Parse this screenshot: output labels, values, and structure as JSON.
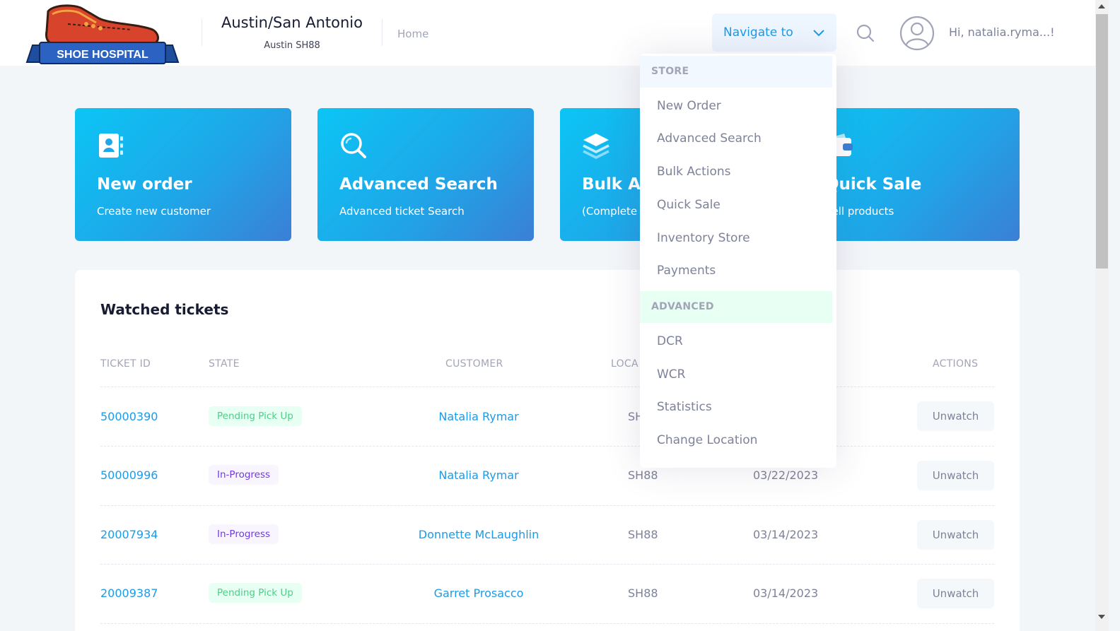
{
  "header": {
    "logo_text": "SHOE HOSPITAL",
    "store_name": "Austin/San Antonio",
    "store_code": "Austin SH88",
    "home_label": "Home",
    "navigate_label": "Navigate to",
    "greeting": "Hi, natalia.ryma...!"
  },
  "cards": [
    {
      "title": "New order",
      "subtitle": "Create new customer",
      "icon": "contact-book-icon"
    },
    {
      "title": "Advanced Search",
      "subtitle": "Advanced ticket Search",
      "icon": "search-icon"
    },
    {
      "title": "Bulk Actions",
      "subtitle": "(Complete",
      "icon": "layers-icon"
    },
    {
      "title": "Quick Sale",
      "subtitle": "Sell products",
      "icon": "wallet-icon"
    }
  ],
  "watched": {
    "title": "Watched tickets",
    "columns": [
      "TICKET ID",
      "STATE",
      "CUSTOMER",
      "LOCA",
      "ACTIONS"
    ],
    "rows": [
      {
        "id": "50000390",
        "state": "Pending Pick Up",
        "customer": "Natalia Rymar",
        "location": "SH",
        "date": "",
        "action": "Unwatch"
      },
      {
        "id": "50000996",
        "state": "In-Progress",
        "customer": "Natalia Rymar",
        "location": "SH88",
        "date": "03/22/2023",
        "action": "Unwatch"
      },
      {
        "id": "20007934",
        "state": "In-Progress",
        "customer": "Donnette McLaughlin",
        "location": "SH88",
        "date": "03/14/2023",
        "action": "Unwatch"
      },
      {
        "id": "20009387",
        "state": "Pending Pick Up",
        "customer": "Garret Prosacco",
        "location": "SH88",
        "date": "03/14/2023",
        "action": "Unwatch"
      }
    ]
  },
  "menu": {
    "store_section": "STORE",
    "store_items": [
      "New Order",
      "Advanced Search",
      "Bulk Actions",
      "Quick Sale",
      "Inventory Store",
      "Payments"
    ],
    "advanced_section": "ADVANCED",
    "advanced_items": [
      "DCR",
      "WCR",
      "Statistics",
      "Change Location"
    ]
  },
  "colors": {
    "accent": "#1b9be8",
    "pending": "#50cd89",
    "in_progress": "#7239ea"
  }
}
